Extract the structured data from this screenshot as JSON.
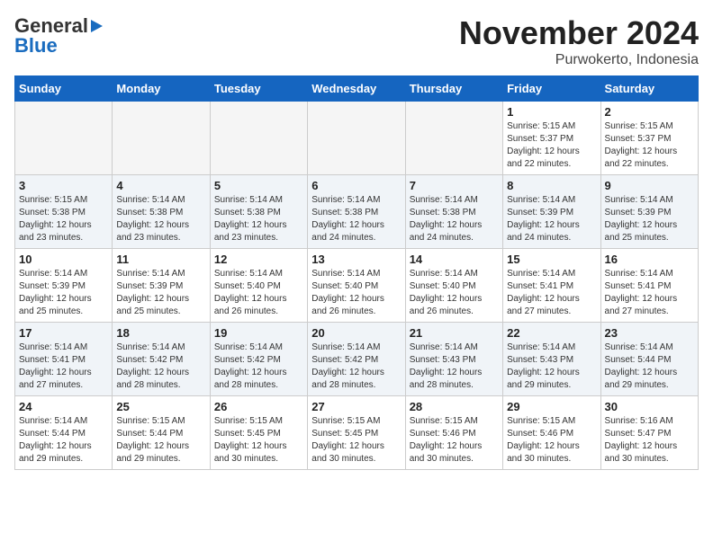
{
  "header": {
    "logo_general": "General",
    "logo_blue": "Blue",
    "month_title": "November 2024",
    "location": "Purwokerto, Indonesia"
  },
  "days_of_week": [
    "Sunday",
    "Monday",
    "Tuesday",
    "Wednesday",
    "Thursday",
    "Friday",
    "Saturday"
  ],
  "weeks": [
    [
      {
        "day": "",
        "empty": true
      },
      {
        "day": "",
        "empty": true
      },
      {
        "day": "",
        "empty": true
      },
      {
        "day": "",
        "empty": true
      },
      {
        "day": "",
        "empty": true
      },
      {
        "day": "1",
        "sunrise": "5:15 AM",
        "sunset": "5:37 PM",
        "daylight": "12 hours and 22 minutes."
      },
      {
        "day": "2",
        "sunrise": "5:15 AM",
        "sunset": "5:37 PM",
        "daylight": "12 hours and 22 minutes."
      }
    ],
    [
      {
        "day": "3",
        "sunrise": "5:15 AM",
        "sunset": "5:38 PM",
        "daylight": "12 hours and 23 minutes."
      },
      {
        "day": "4",
        "sunrise": "5:14 AM",
        "sunset": "5:38 PM",
        "daylight": "12 hours and 23 minutes."
      },
      {
        "day": "5",
        "sunrise": "5:14 AM",
        "sunset": "5:38 PM",
        "daylight": "12 hours and 23 minutes."
      },
      {
        "day": "6",
        "sunrise": "5:14 AM",
        "sunset": "5:38 PM",
        "daylight": "12 hours and 24 minutes."
      },
      {
        "day": "7",
        "sunrise": "5:14 AM",
        "sunset": "5:38 PM",
        "daylight": "12 hours and 24 minutes."
      },
      {
        "day": "8",
        "sunrise": "5:14 AM",
        "sunset": "5:39 PM",
        "daylight": "12 hours and 24 minutes."
      },
      {
        "day": "9",
        "sunrise": "5:14 AM",
        "sunset": "5:39 PM",
        "daylight": "12 hours and 25 minutes."
      }
    ],
    [
      {
        "day": "10",
        "sunrise": "5:14 AM",
        "sunset": "5:39 PM",
        "daylight": "12 hours and 25 minutes."
      },
      {
        "day": "11",
        "sunrise": "5:14 AM",
        "sunset": "5:39 PM",
        "daylight": "12 hours and 25 minutes."
      },
      {
        "day": "12",
        "sunrise": "5:14 AM",
        "sunset": "5:40 PM",
        "daylight": "12 hours and 26 minutes."
      },
      {
        "day": "13",
        "sunrise": "5:14 AM",
        "sunset": "5:40 PM",
        "daylight": "12 hours and 26 minutes."
      },
      {
        "day": "14",
        "sunrise": "5:14 AM",
        "sunset": "5:40 PM",
        "daylight": "12 hours and 26 minutes."
      },
      {
        "day": "15",
        "sunrise": "5:14 AM",
        "sunset": "5:41 PM",
        "daylight": "12 hours and 27 minutes."
      },
      {
        "day": "16",
        "sunrise": "5:14 AM",
        "sunset": "5:41 PM",
        "daylight": "12 hours and 27 minutes."
      }
    ],
    [
      {
        "day": "17",
        "sunrise": "5:14 AM",
        "sunset": "5:41 PM",
        "daylight": "12 hours and 27 minutes."
      },
      {
        "day": "18",
        "sunrise": "5:14 AM",
        "sunset": "5:42 PM",
        "daylight": "12 hours and 28 minutes."
      },
      {
        "day": "19",
        "sunrise": "5:14 AM",
        "sunset": "5:42 PM",
        "daylight": "12 hours and 28 minutes."
      },
      {
        "day": "20",
        "sunrise": "5:14 AM",
        "sunset": "5:42 PM",
        "daylight": "12 hours and 28 minutes."
      },
      {
        "day": "21",
        "sunrise": "5:14 AM",
        "sunset": "5:43 PM",
        "daylight": "12 hours and 28 minutes."
      },
      {
        "day": "22",
        "sunrise": "5:14 AM",
        "sunset": "5:43 PM",
        "daylight": "12 hours and 29 minutes."
      },
      {
        "day": "23",
        "sunrise": "5:14 AM",
        "sunset": "5:44 PM",
        "daylight": "12 hours and 29 minutes."
      }
    ],
    [
      {
        "day": "24",
        "sunrise": "5:14 AM",
        "sunset": "5:44 PM",
        "daylight": "12 hours and 29 minutes."
      },
      {
        "day": "25",
        "sunrise": "5:15 AM",
        "sunset": "5:44 PM",
        "daylight": "12 hours and 29 minutes."
      },
      {
        "day": "26",
        "sunrise": "5:15 AM",
        "sunset": "5:45 PM",
        "daylight": "12 hours and 30 minutes."
      },
      {
        "day": "27",
        "sunrise": "5:15 AM",
        "sunset": "5:45 PM",
        "daylight": "12 hours and 30 minutes."
      },
      {
        "day": "28",
        "sunrise": "5:15 AM",
        "sunset": "5:46 PM",
        "daylight": "12 hours and 30 minutes."
      },
      {
        "day": "29",
        "sunrise": "5:15 AM",
        "sunset": "5:46 PM",
        "daylight": "12 hours and 30 minutes."
      },
      {
        "day": "30",
        "sunrise": "5:16 AM",
        "sunset": "5:47 PM",
        "daylight": "12 hours and 30 minutes."
      }
    ]
  ]
}
